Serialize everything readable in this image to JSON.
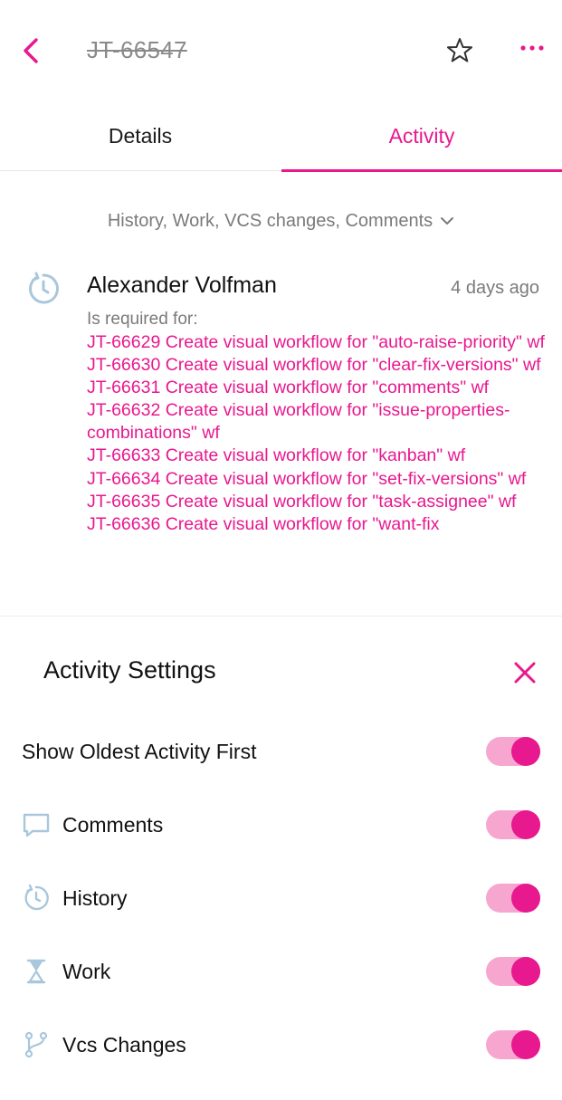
{
  "header": {
    "issue_id": "JT-66547"
  },
  "tabs": {
    "details": "Details",
    "activity": "Activity"
  },
  "filter": {
    "label": "History, Work, VCS changes, Comments"
  },
  "activity_item": {
    "author": "Alexander Volfman",
    "time": "4 days ago",
    "relation_label": "Is required for:",
    "links": [
      "JT-66629 Create visual workflow for \"auto-raise-priority\" wf",
      "JT-66630 Create visual workflow for \"clear-fix-versions\" wf",
      "JT-66631 Create visual workflow for \"comments\" wf",
      "JT-66632 Create visual workflow for \"issue-properties-combinations\" wf",
      "JT-66633 Create visual workflow for \"kanban\" wf",
      "JT-66634 Create visual workflow for \"set-fix-versions\" wf",
      "JT-66635 Create visual workflow for \"task-assignee\" wf",
      "JT-66636 Create visual workflow for \"want-fix"
    ]
  },
  "settings": {
    "title": "Activity Settings",
    "options": [
      {
        "label": "Show Oldest Activity First",
        "enabled": true
      },
      {
        "label": "Comments",
        "icon": "comment-icon",
        "enabled": true
      },
      {
        "label": "History",
        "icon": "history-icon",
        "enabled": true
      },
      {
        "label": "Work",
        "icon": "hourglass-icon",
        "enabled": true
      },
      {
        "label": "Vcs Changes",
        "icon": "vcs-branch-icon",
        "enabled": true
      }
    ]
  },
  "colors": {
    "accent": "#e8188f",
    "toggle_track": "#f7a6d0",
    "muted_text": "#7a7a7a",
    "icon_muted": "#a9c7dc"
  }
}
